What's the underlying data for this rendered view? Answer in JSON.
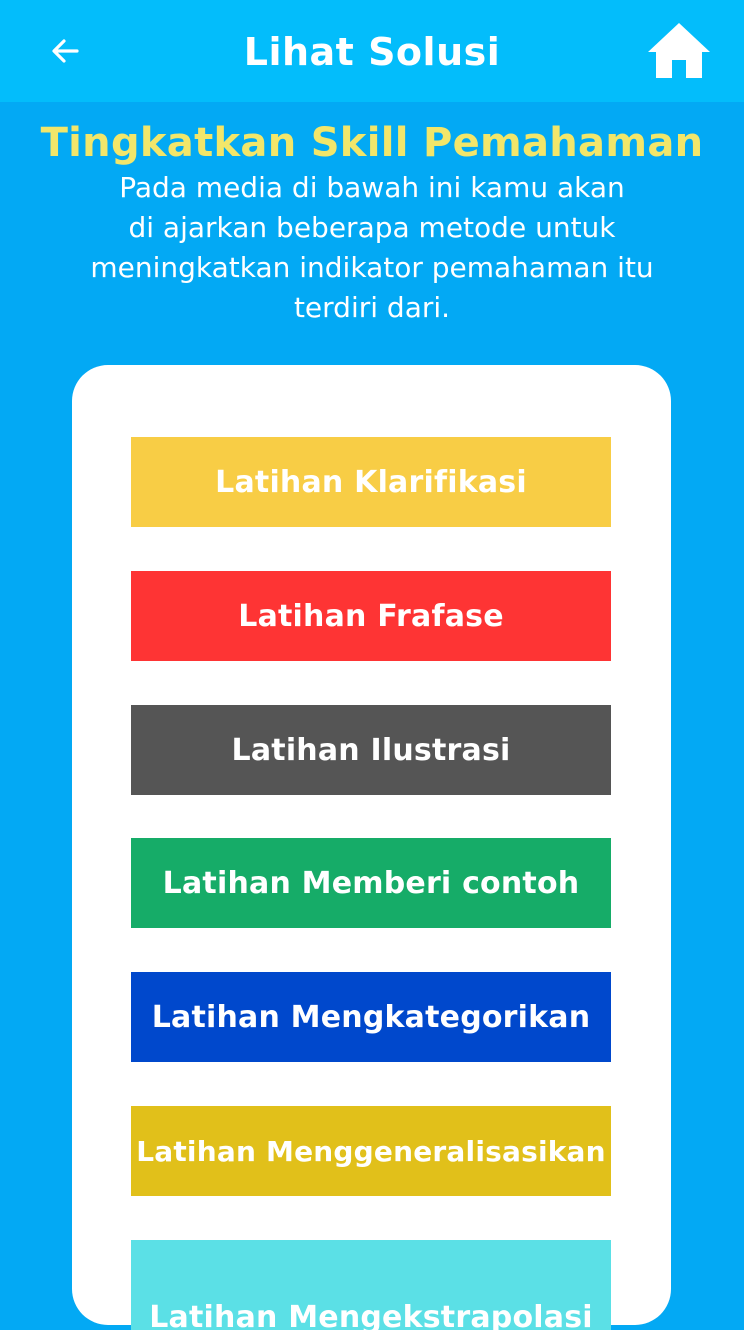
{
  "appbar": {
    "title": "Lihat Solusi",
    "back_icon": "arrow-left-icon",
    "home_icon": "home-icon"
  },
  "content": {
    "heading": "Tingkatkan Skill Pemahaman",
    "description_lines": [
      "Pada media di bawah ini kamu akan",
      "di ajarkan beberapa metode untuk",
      "meningkatkan indikator pemahaman itu",
      "terdiri dari."
    ]
  },
  "menu": {
    "items": [
      {
        "label": "Latihan Klarifikasi",
        "color": "#f8cd45"
      },
      {
        "label": "Latihan Frafase",
        "color": "#fe3434"
      },
      {
        "label": "Latihan Ilustrasi",
        "color": "#555555"
      },
      {
        "label": "Latihan Memberi contoh",
        "color": "#16ac68"
      },
      {
        "label": "Latihan Mengkategorikan",
        "color": "#0048cc"
      },
      {
        "label": "Latihan Menggeneralisasikan",
        "color": "#e1c01a"
      },
      {
        "label": "Latihan Mengekstrapolasi",
        "color": "#5be0e6"
      }
    ]
  },
  "colors": {
    "background": "#03a9f4",
    "appbar": "#03bdfb",
    "heading": "#f2e66a"
  }
}
